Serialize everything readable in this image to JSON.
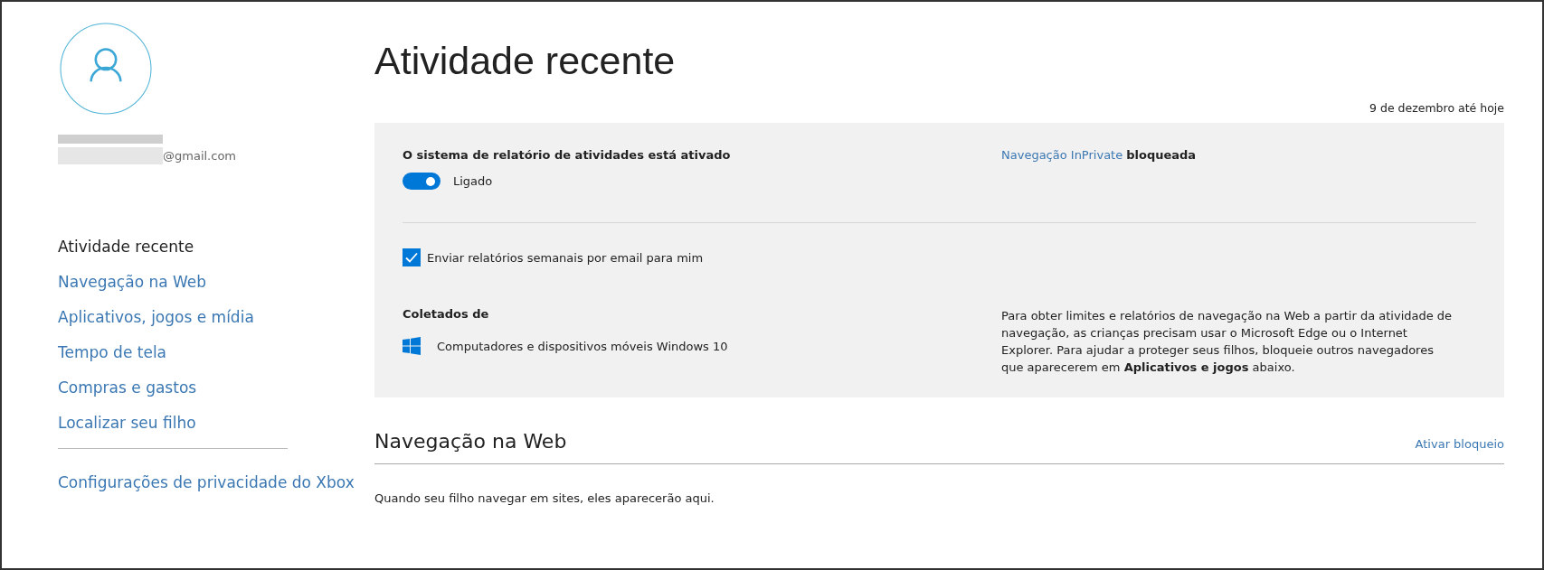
{
  "profile": {
    "email": "@gmail.com"
  },
  "sidebar": {
    "items": [
      {
        "label": "Atividade recente",
        "selected": true
      },
      {
        "label": "Navegação na Web",
        "selected": false
      },
      {
        "label": "Aplicativos, jogos e mídia",
        "selected": false
      },
      {
        "label": "Tempo de tela",
        "selected": false
      },
      {
        "label": "Compras e gastos",
        "selected": false
      },
      {
        "label": "Localizar seu filho",
        "selected": false
      }
    ],
    "footer_link": "Configurações de privacidade do Xbox"
  },
  "page": {
    "title": "Atividade recente",
    "date_range": "9 de dezembro até hoje"
  },
  "panel": {
    "reporting_heading": "O sistema de relatório de atividades está ativado",
    "toggle": {
      "label": "Ligado",
      "on": true
    },
    "inprivate_link": "Navegação InPrivate",
    "inprivate_status": "bloqueada",
    "weekly_email": {
      "label": "Enviar relatórios semanais por email para mim",
      "checked": true
    },
    "collected_heading": "Coletados de",
    "device": "Computadores e dispositivos móveis Windows 10",
    "info": "Para obter limites e relatórios de navegação na Web a partir da atividade de navegação, as crianças precisam usar o Microsoft Edge ou o Internet Explorer. Para ajudar a proteger seus filhos, bloqueie outros navegadores que aparecerem em **Aplicativos e jogos** abaixo."
  },
  "web_section": {
    "title": "Navegação na Web",
    "action": "Ativar bloqueio",
    "empty_text": "Quando seu filho navegar em sites, eles aparecerão aqui."
  }
}
